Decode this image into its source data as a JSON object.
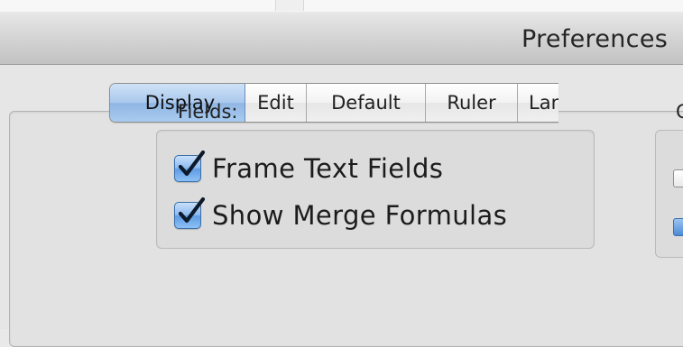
{
  "window": {
    "title": "Preferences"
  },
  "tabs": [
    {
      "label": "Display",
      "selected": true
    },
    {
      "label": "Edit",
      "selected": false
    },
    {
      "label": "Default",
      "selected": false
    },
    {
      "label": "Ruler",
      "selected": false
    },
    {
      "label": "Lang",
      "selected": false
    }
  ],
  "fields_group": {
    "label": "Fields:",
    "options": [
      {
        "label": "Frame Text Fields",
        "checked": true
      },
      {
        "label": "Show Merge Formulas",
        "checked": true
      }
    ]
  },
  "other_group": {
    "label": "C"
  },
  "colors": {
    "selected_tab": "#a9c8ec",
    "checkbox_fill": "#5f9be3",
    "window_bg": "#e6e6e6"
  }
}
